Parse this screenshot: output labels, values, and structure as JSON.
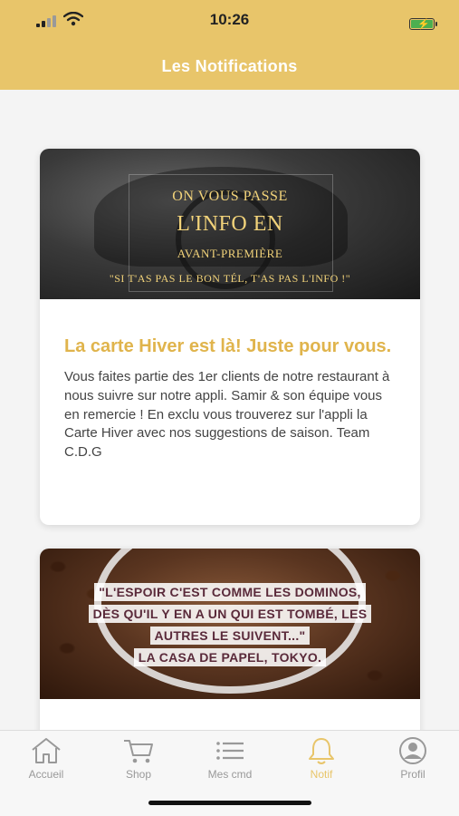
{
  "status_bar": {
    "time": "10:26"
  },
  "header": {
    "title": "Les Notifications",
    "background": "#e8c56a"
  },
  "notifications": [
    {
      "banner_lines": [
        "ON VOUS PASSE",
        "L'INFO EN",
        "AVANT-PREMIÈRE",
        "\"SI T'AS PAS LE BON TÉL, T'AS PAS L'INFO !\""
      ],
      "title": "La carte Hiver est là! Juste pour vous.",
      "body": "Vous faites partie des 1er clients de notre restaurant à nous suivre sur notre appli. Samir & son équipe vous en remercie ! En exclu vous trouverez sur l'appli la Carte Hiver avec nos suggestions de saison. Team C.D.G"
    },
    {
      "banner_lines": [
        "\"L'ESPOIR C'EST COMME LES DOMINOS,",
        "DÈS QU'IL Y EN A UN QUI EST TOMBÉ, LES",
        "AUTRES LE SUIVENT...\"",
        "LA CASA DE PAPEL, TOKYO."
      ]
    }
  ],
  "tabbar": {
    "accent": "#e8c56a",
    "items": [
      {
        "label": "Accueil",
        "icon": "home-icon"
      },
      {
        "label": "Shop",
        "icon": "cart-icon"
      },
      {
        "label": "Mes cmd",
        "icon": "list-icon"
      },
      {
        "label": "Notif",
        "icon": "bell-icon",
        "active": true
      },
      {
        "label": "Profil",
        "icon": "user-icon"
      }
    ]
  }
}
